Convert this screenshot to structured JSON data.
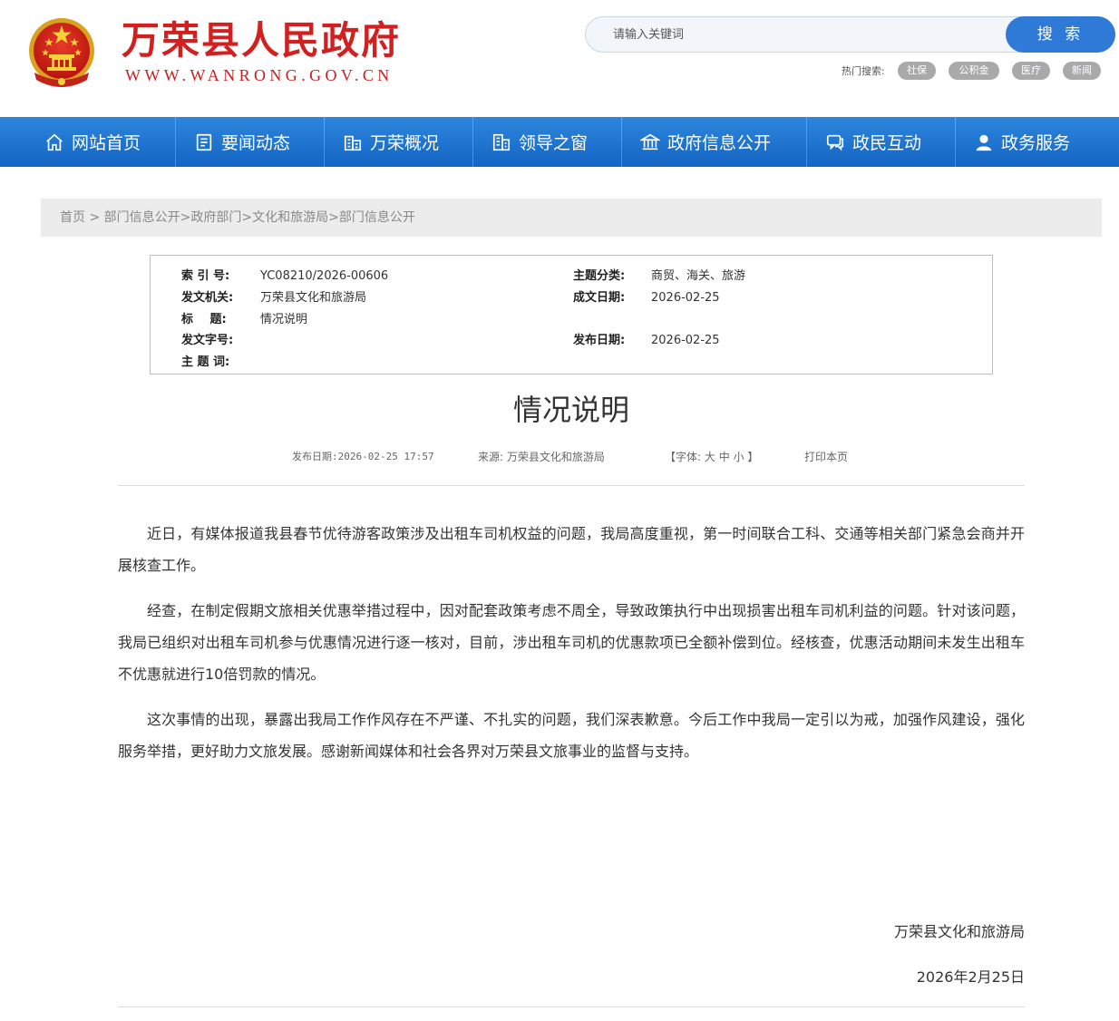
{
  "header": {
    "site_title": "万荣县人民政府",
    "site_domain": "WWW.WANRONG.GOV.CN",
    "search_placeholder": "请输入关键词",
    "search_button": "搜 索",
    "hot_label": "热门搜索:",
    "hot_tags": [
      "社保",
      "公积金",
      "医疗",
      "新闻"
    ]
  },
  "nav": {
    "items": [
      {
        "label": "网站首页",
        "icon": "home-icon"
      },
      {
        "label": "要闻动态",
        "icon": "news-icon"
      },
      {
        "label": "万荣概况",
        "icon": "building-icon"
      },
      {
        "label": "领导之窗",
        "icon": "office-icon"
      },
      {
        "label": "政府信息公开",
        "icon": "bank-icon"
      },
      {
        "label": "政民互动",
        "icon": "chat-icon"
      },
      {
        "label": "政务服务",
        "icon": "user-icon"
      }
    ]
  },
  "breadcrumb": {
    "items": [
      "首页",
      "部门信息公开",
      "政府部门",
      "文化和旅游局",
      "部门信息公开"
    ],
    "sep_first": " > ",
    "sep": ">"
  },
  "info": {
    "index_key": "索 引 号:",
    "index_val": "YC08210/2026-00606",
    "topic_key": "主题分类:",
    "topic_val": "商贸、海关、旅游",
    "issuer_key": "发文机关:",
    "issuer_val": "万荣县文化和旅游局",
    "written_key": "成文日期:",
    "written_val": "2026-02-25",
    "title_key": "标 题:",
    "title_val": "情况说明",
    "docno_key": "发文字号:",
    "docno_val": "",
    "pub_key": "发布日期:",
    "pub_val": "2026-02-25",
    "keywords_key": "主 题 词:",
    "keywords_val": ""
  },
  "article": {
    "title": "情况说明",
    "meta_date": "发布日期:2026-02-25 17:57",
    "meta_source": "来源: 万荣县文化和旅游局",
    "font_open": "【字体:",
    "font_large": "大",
    "font_medium": "中",
    "font_small": "小",
    "font_close": "】",
    "print": "打印本页",
    "paragraphs": [
      "近日，有媒体报道我县春节优待游客政策涉及出租车司机权益的问题，我局高度重视，第一时间联合工科、交通等相关部门紧急会商并开展核查工作。",
      "经查，在制定假期文旅相关优惠举措过程中，因对配套政策考虑不周全，导致政策执行中出现损害出租车司机利益的问题。针对该问题，我局已组织对出租车司机参与优惠情况进行逐一核对，目前，涉出租车司机的优惠款项已全额补偿到位。经核查，优惠活动期间未发生出租车不优惠就进行10倍罚款的情况。",
      "这次事情的出现，暴露出我局工作作风存在不严谨、不扎实的问题，我们深表歉意。今后工作中我局一定引以为戒，加强作风建设，强化服务举措，更好助力文旅发展。感谢新闻媒体和社会各界对万荣县文旅事业的监督与支持。"
    ],
    "sign_org": "万荣县文化和旅游局",
    "sign_date": "2026年2月25日"
  },
  "colors": {
    "brand_red": "#d21f1f",
    "nav_blue": "#1f74d0",
    "search_blue": "#2e7ad6",
    "tag_gray": "#a9a9a9"
  }
}
